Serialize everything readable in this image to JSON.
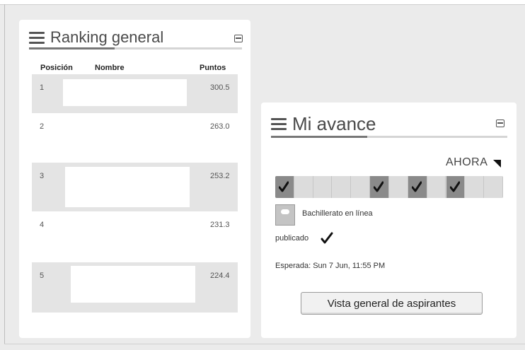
{
  "ranking": {
    "title": "Ranking general",
    "headers": {
      "position": "Posición",
      "name": "Nombre",
      "points": "Puntos"
    },
    "rows": [
      {
        "position": "1",
        "points": "300.5"
      },
      {
        "position": "2",
        "points": "263.0"
      },
      {
        "position": "3",
        "points": "253.2"
      },
      {
        "position": "4",
        "points": "231.3"
      },
      {
        "position": "5",
        "points": "224.4"
      }
    ]
  },
  "avance": {
    "title": "Mi avance",
    "now_label": "AHORA",
    "progress": {
      "segments": 12,
      "completed": [
        1,
        6,
        8,
        10
      ]
    },
    "activity": {
      "name": "Bachillerato en línea",
      "icon": "forum-icon"
    },
    "status": "publicado",
    "due": "Esperada: Sun 7 Jun, 11:55 PM",
    "button_label": "Vista general de aspirantes"
  },
  "colors": {
    "card": "#ffffff",
    "background": "#ebebeb",
    "progress_done": "#8a8a8a",
    "progress_track": "#dcdcdc"
  }
}
